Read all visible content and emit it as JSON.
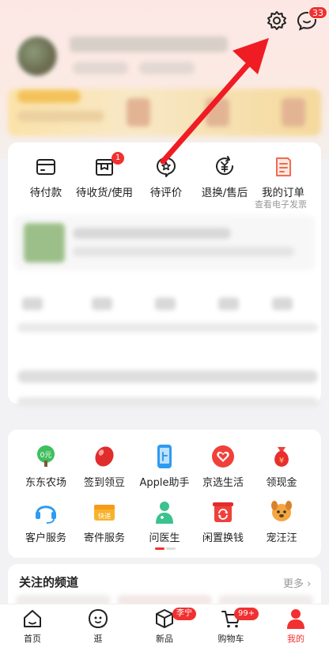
{
  "header": {
    "settings_icon": "gear-icon",
    "message_icon": "message-bubble-icon",
    "message_badge": "33"
  },
  "orders": [
    {
      "label": "待付款",
      "icon": "wallet-icon"
    },
    {
      "label": "待收货/使用",
      "icon": "package-icon",
      "badge": "1"
    },
    {
      "label": "待评价",
      "icon": "review-star-icon"
    },
    {
      "label": "退换/售后",
      "icon": "refund-icon"
    },
    {
      "label": "我的订单",
      "icon": "order-list-icon",
      "sub": "查看电子发票"
    }
  ],
  "services": [
    {
      "label": "东东农场",
      "icon": "farm-tree-icon"
    },
    {
      "label": "签到领豆",
      "icon": "bean-icon"
    },
    {
      "label": "Apple助手",
      "icon": "phone-icon"
    },
    {
      "label": "京选生活",
      "icon": "heart-icon"
    },
    {
      "label": "领现金",
      "icon": "money-bag-icon"
    },
    {
      "label": "客户服务",
      "icon": "headset-icon"
    },
    {
      "label": "寄件服务",
      "icon": "courier-box-icon"
    },
    {
      "label": "问医生",
      "icon": "doctor-icon"
    },
    {
      "label": "闲置换钱",
      "icon": "recycle-icon"
    },
    {
      "label": "宠汪汪",
      "icon": "dog-icon"
    }
  ],
  "channels": {
    "title": "关注的频道",
    "more": "更多 ›"
  },
  "bottom_nav": [
    {
      "label": "首页",
      "icon": "home-icon"
    },
    {
      "label": "逛",
      "icon": "explore-face-icon"
    },
    {
      "label": "新品",
      "icon": "cube-icon",
      "tag": "李宁"
    },
    {
      "label": "购物车",
      "icon": "cart-icon",
      "tag": "99+"
    },
    {
      "label": "我的",
      "icon": "profile-icon",
      "active": true
    }
  ],
  "colors": {
    "accent": "#f23030",
    "arrow": "#ef1c24"
  }
}
